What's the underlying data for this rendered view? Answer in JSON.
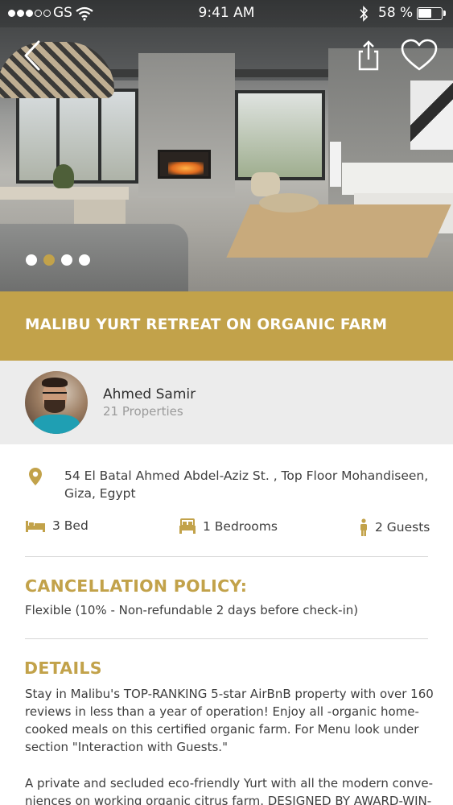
{
  "status_bar": {
    "carrier": "GS",
    "time": "9:41 AM",
    "battery_percent": "58 %",
    "battery_level": 0.58,
    "signal_bars_filled": 3,
    "signal_bars_total": 5
  },
  "hero": {
    "gallery_pages": 4,
    "active_page_index": 1
  },
  "listing": {
    "title": "MALIBU YURT RETREAT ON ORGANIC FARM"
  },
  "host": {
    "name": "Ahmed Samir",
    "properties": "21 Properties"
  },
  "location": {
    "address": "54 El Batal Ahmed Abdel-Aziz St. , Top Floor Mohandiseen, Giza, Egypt"
  },
  "features": {
    "beds": "3 Bed",
    "bedrooms": "1 Bedrooms",
    "guests": "2 Guests"
  },
  "cancellation": {
    "heading": "CANCELLATION POLICY:",
    "text": "Flexible (10% - Non-refundable 2 days before check-in)"
  },
  "details": {
    "heading": "DETAILS",
    "paragraph1": "Stay in Malibu's TOP-RANKING 5-star AirBnB property with over 160 reviews in less than a year of operation! Enjoy all -organic home-cooked meals on this certified organic farm. For Menu look under section \"Interaction with Guests.\"",
    "paragraph2": "A private and secluded eco-friendly Yurt with all the modern conve-niences on working organic citrus farm. DESIGNED BY AWARD-WIN-"
  },
  "colors": {
    "accent": "#c2a24a",
    "host_background": "#ececec",
    "text": "#3e3e3e",
    "muted": "#9a9a9a"
  },
  "icons": [
    "back-chevron-icon",
    "share-icon",
    "heart-icon",
    "location-pin-icon",
    "bed-icon",
    "bedroom-icon",
    "person-icon",
    "wifi-icon",
    "bluetooth-icon",
    "battery-icon"
  ]
}
